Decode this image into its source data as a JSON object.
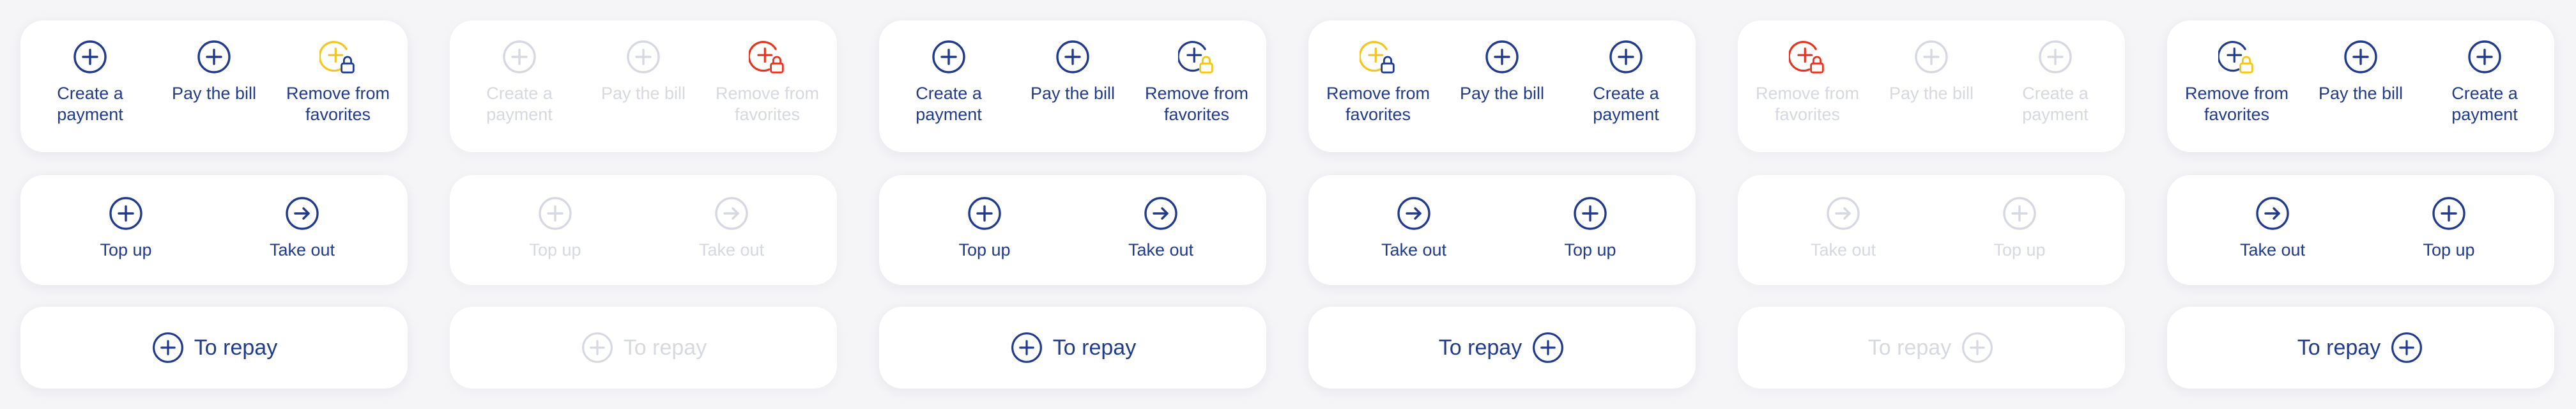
{
  "colors": {
    "primary": "#1f3a8f",
    "disabled": "#d6d8e2",
    "favorite_yellow": "#f5c518",
    "favorite_red": "#e8321e",
    "lock_blue": "#1f3a8f"
  },
  "panels": [
    {
      "state": "enabled",
      "top": [
        {
          "label": "Create a\npayment",
          "icon": "plus-circle-icon"
        },
        {
          "label": "Pay the bill",
          "icon": "plus-circle-icon"
        },
        {
          "label": "Remove from\nfavorites",
          "icon": "favorite-lock-icon",
          "accent": "yellow"
        }
      ],
      "middle": [
        {
          "label": "Top up",
          "icon": "plus-circle-icon"
        },
        {
          "label": "Take out",
          "icon": "arrow-right-circle-icon"
        }
      ],
      "bottom": {
        "label": "To repay",
        "icon": "plus-circle-icon",
        "icon_side": "left"
      }
    },
    {
      "state": "disabled",
      "top": [
        {
          "label": "Create a\npayment",
          "icon": "plus-circle-icon"
        },
        {
          "label": "Pay the bill",
          "icon": "plus-circle-icon"
        },
        {
          "label": "Remove from\nfavorites",
          "icon": "favorite-lock-icon",
          "accent": "red"
        }
      ],
      "middle": [
        {
          "label": "Top up",
          "icon": "plus-circle-icon"
        },
        {
          "label": "Take out",
          "icon": "arrow-right-circle-icon"
        }
      ],
      "bottom": {
        "label": "To repay",
        "icon": "plus-circle-icon",
        "icon_side": "left"
      }
    },
    {
      "state": "enabled",
      "top": [
        {
          "label": "Create a\npayment",
          "icon": "plus-circle-icon"
        },
        {
          "label": "Pay the bill",
          "icon": "plus-circle-icon"
        },
        {
          "label": "Remove from\nfavorites",
          "icon": "favorite-lock-icon",
          "accent": "yellow-lock"
        }
      ],
      "middle": [
        {
          "label": "Top up",
          "icon": "plus-circle-icon"
        },
        {
          "label": "Take out",
          "icon": "arrow-right-circle-icon"
        }
      ],
      "bottom": {
        "label": "To repay",
        "icon": "plus-circle-icon",
        "icon_side": "left"
      }
    },
    {
      "state": "enabled",
      "top": [
        {
          "label": "Remove from\nfavorites",
          "icon": "favorite-lock-icon",
          "accent": "yellow"
        },
        {
          "label": "Pay the bill",
          "icon": "plus-circle-icon"
        },
        {
          "label": "Create a\npayment",
          "icon": "plus-circle-icon"
        }
      ],
      "middle": [
        {
          "label": "Take out",
          "icon": "arrow-right-circle-icon"
        },
        {
          "label": "Top up",
          "icon": "plus-circle-icon"
        }
      ],
      "bottom": {
        "label": "To repay",
        "icon": "plus-circle-icon",
        "icon_side": "right"
      }
    },
    {
      "state": "disabled",
      "top": [
        {
          "label": "Remove from\nfavorites",
          "icon": "favorite-lock-icon",
          "accent": "red"
        },
        {
          "label": "Pay the bill",
          "icon": "plus-circle-icon"
        },
        {
          "label": "Create a\npayment",
          "icon": "plus-circle-icon"
        }
      ],
      "middle": [
        {
          "label": "Take out",
          "icon": "arrow-right-circle-icon"
        },
        {
          "label": "Top up",
          "icon": "plus-circle-icon"
        }
      ],
      "bottom": {
        "label": "To repay",
        "icon": "plus-circle-icon",
        "icon_side": "right"
      }
    },
    {
      "state": "enabled",
      "top": [
        {
          "label": "Remove from\nfavorites",
          "icon": "favorite-lock-icon",
          "accent": "yellow-lock"
        },
        {
          "label": "Pay the bill",
          "icon": "plus-circle-icon"
        },
        {
          "label": "Create a\npayment",
          "icon": "plus-circle-icon"
        }
      ],
      "middle": [
        {
          "label": "Take out",
          "icon": "arrow-right-circle-icon"
        },
        {
          "label": "Top up",
          "icon": "plus-circle-icon"
        }
      ],
      "bottom": {
        "label": "To repay",
        "icon": "plus-circle-icon",
        "icon_side": "right"
      }
    }
  ]
}
